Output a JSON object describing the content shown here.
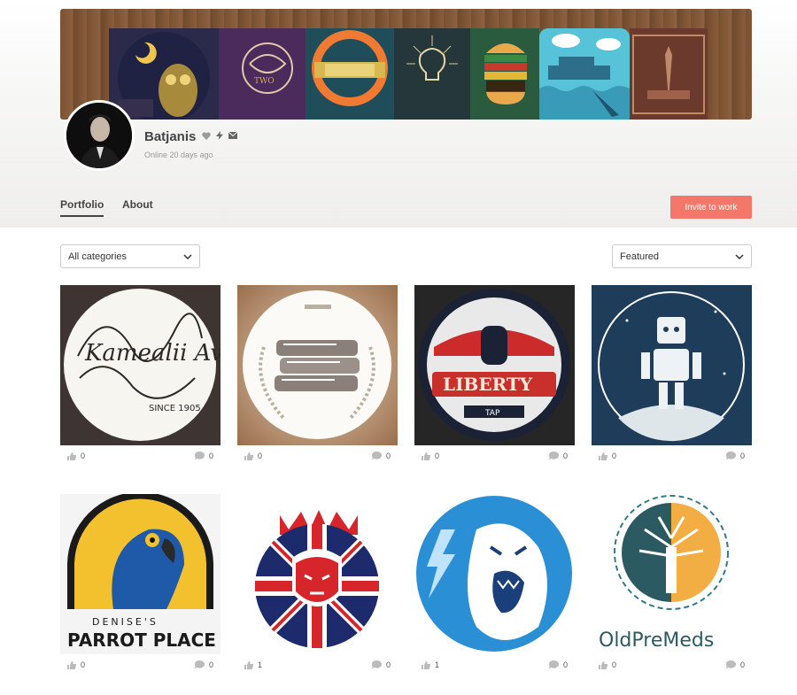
{
  "profile": {
    "name": "Batjanis",
    "status": "Online 20 days ago",
    "icons": [
      "heart-icon",
      "lightning-icon",
      "envelope-icon"
    ]
  },
  "tabs": [
    {
      "label": "Portfolio",
      "active": true
    },
    {
      "label": "About",
      "active": false
    }
  ],
  "invite_label": "Invite to work",
  "filters": {
    "category": "All categories",
    "sort": "Featured"
  },
  "cover_tiles": [
    {
      "name": "owl-night-artwork",
      "color": "#2c2a4a"
    },
    {
      "name": "always-lettering-artwork",
      "color": "#4a2b5c"
    },
    {
      "name": "lifebuoy-artwork",
      "color": "#1f4d5a"
    },
    {
      "name": "bulb-lettering-artwork",
      "color": "#26373b"
    },
    {
      "name": "burger-artwork",
      "color": "#2b5b3e"
    },
    {
      "name": "ship-artwork",
      "color": "#57c3d8"
    },
    {
      "name": "liberty-artwork",
      "color": "#6b3a2c"
    }
  ],
  "portfolio": [
    {
      "title": "Kamealii Avenue",
      "subtitle": "SINCE 1905",
      "likes": "0",
      "comments": "0"
    },
    {
      "title": "Books crest",
      "likes": "0",
      "comments": "0"
    },
    {
      "title": "LIBERTY",
      "subtitle": "TAP",
      "likes": "0",
      "comments": "0"
    },
    {
      "title": "Robot",
      "likes": "0",
      "comments": "0"
    },
    {
      "title": "PARROT PLACE",
      "subtitle": "DENISE'S",
      "likes": "0",
      "comments": "0"
    },
    {
      "title": "Lion crest",
      "likes": "1",
      "comments": "0"
    },
    {
      "title": "Gorilla",
      "likes": "1",
      "comments": "0"
    },
    {
      "title": "OldPreMeds",
      "likes": "0",
      "comments": "0"
    }
  ]
}
